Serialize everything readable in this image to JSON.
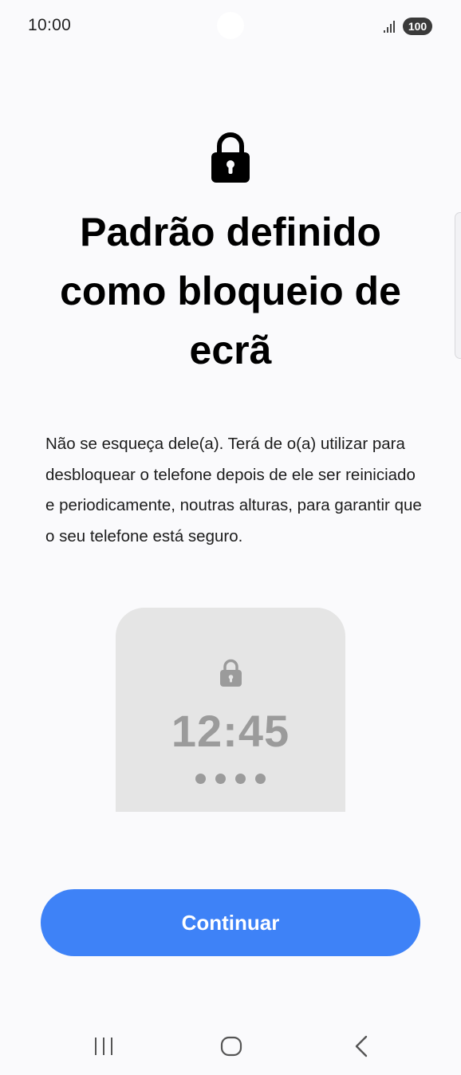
{
  "status_bar": {
    "time": "10:00",
    "battery": "100",
    "signal_icon": "signal-bars-icon"
  },
  "header": {
    "icon": "lock-icon",
    "title": "Padrão definido como bloqueio de ecrã"
  },
  "description": "Não se esqueça dele(a). Terá de o(a) utilizar para desbloquear o telefone depois de ele ser reiniciado e periodicamente, noutras alturas, para garantir que o seu telefone está seguro.",
  "preview": {
    "icon": "lock-icon",
    "time": "12:45"
  },
  "actions": {
    "continue_label": "Continuar"
  },
  "nav_bar": {
    "recent_icon": "recent-apps-icon",
    "home_icon": "home-icon",
    "back_icon": "back-icon"
  },
  "colors": {
    "accent": "#3e82f7",
    "background": "#fafafc",
    "preview_background": "#e5e5e5",
    "preview_foreground": "#9b9b9b"
  }
}
